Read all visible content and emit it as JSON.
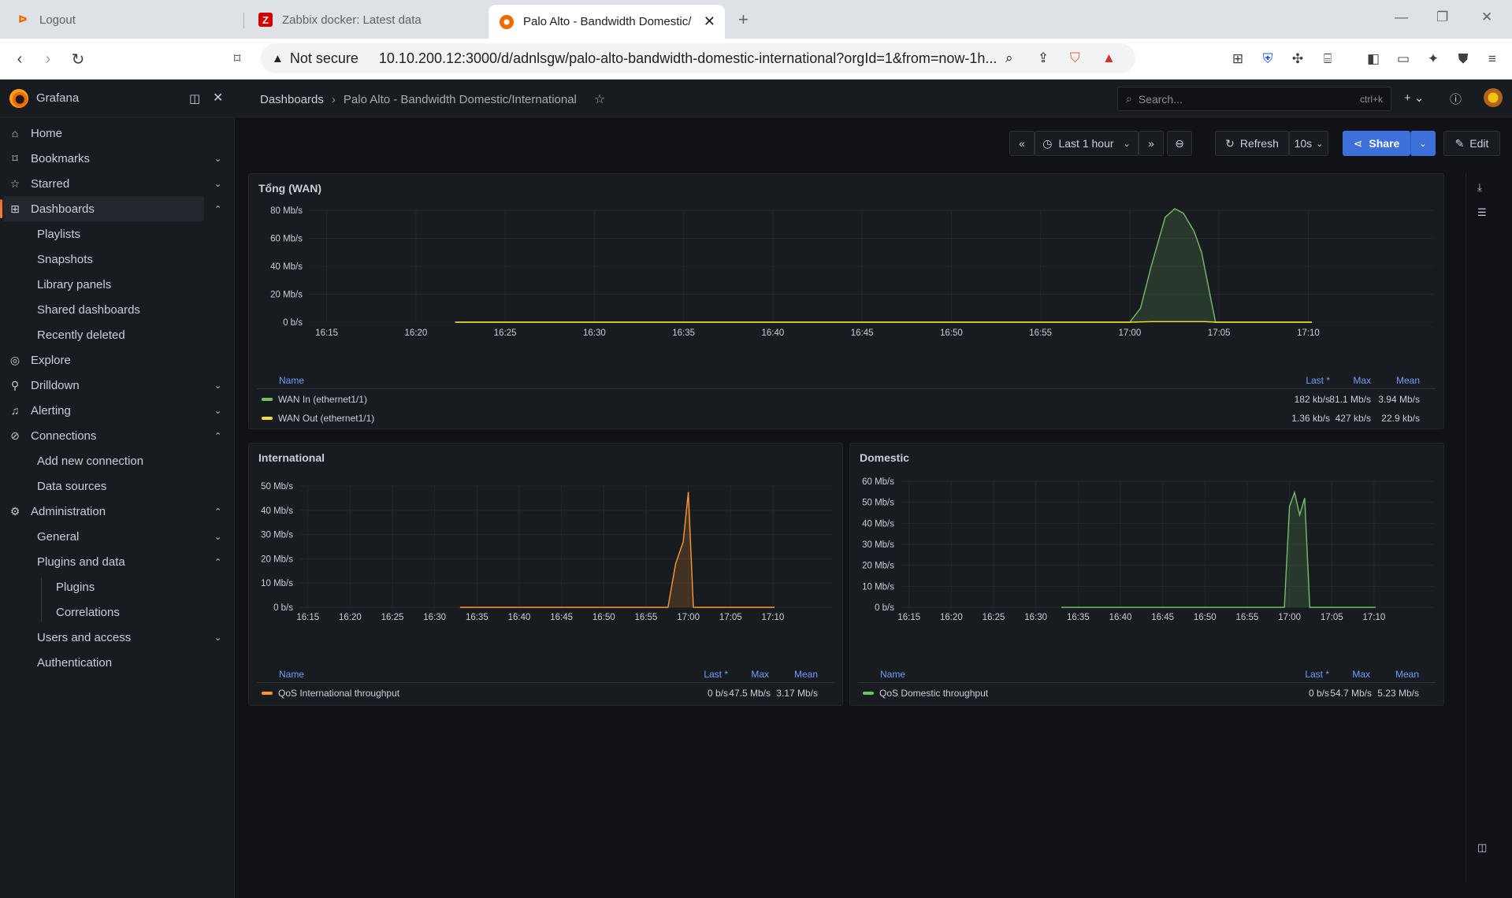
{
  "browser": {
    "tabs": [
      {
        "title": "Logout"
      },
      {
        "title": "Zabbix docker: Latest data"
      },
      {
        "title": "Palo Alto - Bandwidth Domestic/"
      }
    ],
    "security_label": "Not secure",
    "url": "10.10.200.12:3000/d/adnlsgw/palo-alto-bandwidth-domestic-international?orgId=1&from=now-1h..."
  },
  "grafana": {
    "brand": "Grafana",
    "breadcrumb": {
      "root": "Dashboards",
      "current": "Palo Alto - Bandwidth Domestic/International"
    },
    "search": {
      "placeholder": "Search...",
      "shortcut": "ctrl+k"
    },
    "nav": {
      "home": "Home",
      "bookmarks": "Bookmarks",
      "starred": "Starred",
      "dashboards": "Dashboards",
      "playlists": "Playlists",
      "snapshots": "Snapshots",
      "library_panels": "Library panels",
      "shared_dashboards": "Shared dashboards",
      "recently_deleted": "Recently deleted",
      "explore": "Explore",
      "drilldown": "Drilldown",
      "alerting": "Alerting",
      "connections": "Connections",
      "add_new_connection": "Add new connection",
      "data_sources": "Data sources",
      "administration": "Administration",
      "general": "General",
      "plugins_and_data": "Plugins and data",
      "plugins": "Plugins",
      "correlations": "Correlations",
      "users_and_access": "Users and access",
      "authentication": "Authentication"
    },
    "controls": {
      "time_range": "Last 1 hour",
      "refresh": "Refresh",
      "interval": "10s",
      "share": "Share",
      "edit": "Edit"
    },
    "legend_headers": {
      "name": "Name",
      "last": "Last *",
      "max": "Max",
      "mean": "Mean"
    }
  },
  "chart_data": [
    {
      "type": "area",
      "title": "Tổng (WAN)",
      "x_ticks": [
        "16:15",
        "16:20",
        "16:25",
        "16:30",
        "16:35",
        "16:40",
        "16:45",
        "16:50",
        "16:55",
        "17:00",
        "17:05",
        "17:10"
      ],
      "y_ticks": [
        "0 b/s",
        "20 Mb/s",
        "40 Mb/s",
        "60 Mb/s",
        "80 Mb/s"
      ],
      "ylim": [
        0,
        80
      ],
      "unit": "Mb/s",
      "series": [
        {
          "name": "WAN In (ethernet1/1)",
          "color": "#73bf69",
          "last": "182 kb/s",
          "max": "81.1 Mb/s",
          "mean": "3.94 Mb/s",
          "points": [
            [
              16.37,
              0
            ],
            [
              17.0,
              0
            ],
            [
              17.01,
              10
            ],
            [
              17.02,
              40
            ],
            [
              17.033,
              75
            ],
            [
              17.042,
              81.1
            ],
            [
              17.05,
              78
            ],
            [
              17.06,
              65
            ],
            [
              17.067,
              50
            ],
            [
              17.08,
              0
            ],
            [
              17.17,
              0
            ]
          ]
        },
        {
          "name": "WAN Out (ethernet1/1)",
          "color": "#fade2a",
          "last": "1.36 kb/s",
          "max": "427 kb/s",
          "mean": "22.9 kb/s",
          "points": [
            [
              16.37,
              0
            ],
            [
              17.0,
              0
            ],
            [
              17.02,
              0.4
            ],
            [
              17.07,
              0.4
            ],
            [
              17.08,
              0
            ],
            [
              17.17,
              0
            ]
          ]
        }
      ]
    },
    {
      "type": "area",
      "title": "International",
      "x_ticks": [
        "16:15",
        "16:20",
        "16:25",
        "16:30",
        "16:35",
        "16:40",
        "16:45",
        "16:50",
        "16:55",
        "17:00",
        "17:05",
        "17:10"
      ],
      "y_ticks": [
        "0 b/s",
        "10 Mb/s",
        "20 Mb/s",
        "30 Mb/s",
        "40 Mb/s",
        "50 Mb/s"
      ],
      "ylim": [
        0,
        50
      ],
      "unit": "Mb/s",
      "series": [
        {
          "name": "QoS International throughput",
          "color": "#ff9830",
          "last": "0 b/s",
          "max": "47.5 Mb/s",
          "mean": "3.17 Mb/s",
          "points": [
            [
              16.55,
              0
            ],
            [
              16.96,
              0
            ],
            [
              16.975,
              18
            ],
            [
              16.99,
              27
            ],
            [
              17.0,
              47.5
            ],
            [
              17.01,
              0
            ],
            [
              17.17,
              0
            ]
          ]
        }
      ]
    },
    {
      "type": "area",
      "title": "Domestic",
      "x_ticks": [
        "16:15",
        "16:20",
        "16:25",
        "16:30",
        "16:35",
        "16:40",
        "16:45",
        "16:50",
        "16:55",
        "17:00",
        "17:05",
        "17:10"
      ],
      "y_ticks": [
        "0 b/s",
        "10 Mb/s",
        "20 Mb/s",
        "30 Mb/s",
        "40 Mb/s",
        "50 Mb/s",
        "60 Mb/s"
      ],
      "ylim": [
        0,
        60
      ],
      "unit": "Mb/s",
      "series": [
        {
          "name": "QoS Domestic throughput",
          "color": "#73bf69",
          "last": "0 b/s",
          "max": "54.7 Mb/s",
          "mean": "5.23 Mb/s",
          "points": [
            [
              16.55,
              0
            ],
            [
              16.99,
              0
            ],
            [
              17.0,
              48
            ],
            [
              17.01,
              54.7
            ],
            [
              17.02,
              44
            ],
            [
              17.03,
              52
            ],
            [
              17.04,
              0
            ],
            [
              17.17,
              0
            ]
          ]
        }
      ]
    }
  ]
}
